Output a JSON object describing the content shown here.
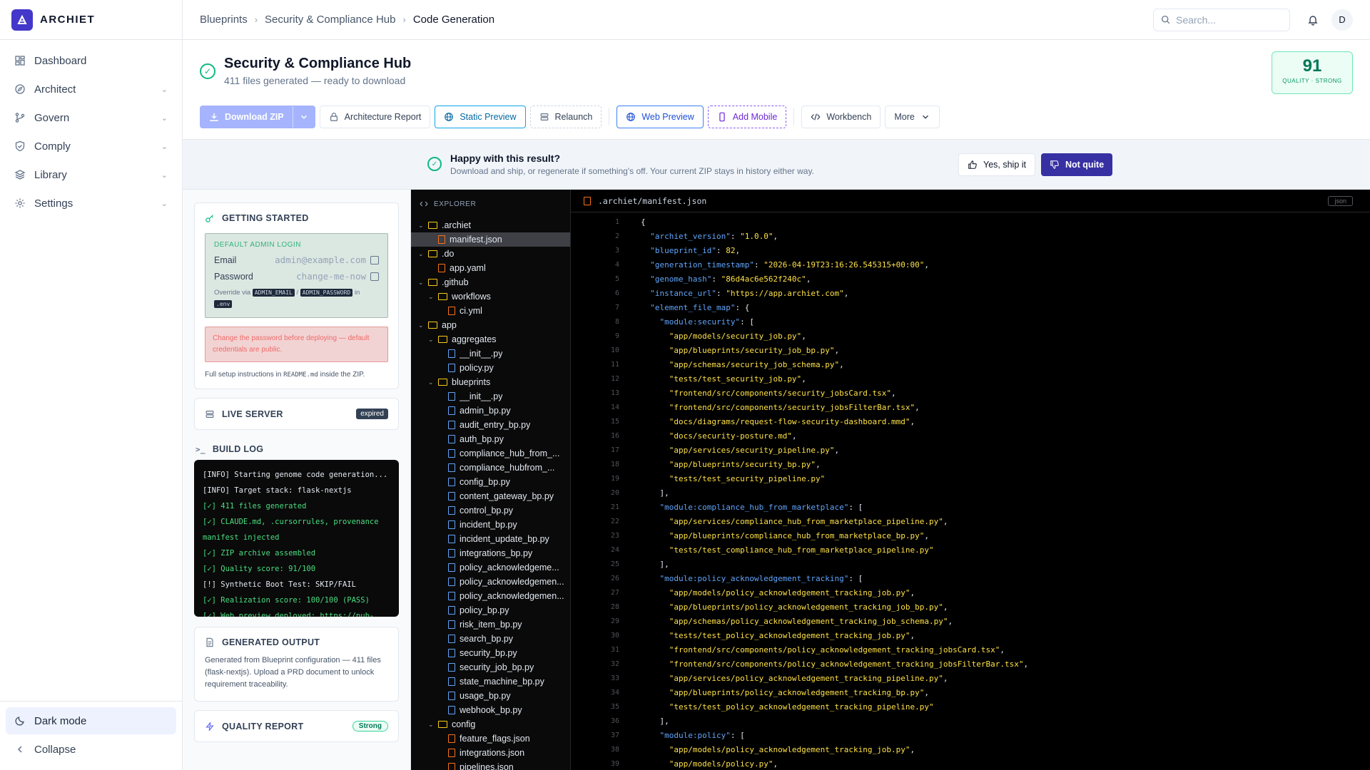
{
  "brand": {
    "name": "ARCHIET"
  },
  "nav": [
    {
      "label": "Dashboard",
      "icon": "dashboard-icon",
      "has_chevron": false
    },
    {
      "label": "Architect",
      "icon": "compass-icon",
      "has_chevron": true
    },
    {
      "label": "Govern",
      "icon": "git-branch-icon",
      "has_chevron": true
    },
    {
      "label": "Comply",
      "icon": "shield-icon",
      "has_chevron": true
    },
    {
      "label": "Library",
      "icon": "layers-icon",
      "has_chevron": true
    },
    {
      "label": "Settings",
      "icon": "gear-icon",
      "has_chevron": true
    }
  ],
  "sidebar_bottom": {
    "dark_mode": "Dark mode",
    "collapse": "Collapse"
  },
  "breadcrumb": [
    "Blueprints",
    "Security & Compliance Hub",
    "Code Generation"
  ],
  "search": {
    "placeholder": "Search..."
  },
  "user": {
    "initial": "D"
  },
  "project": {
    "title": "Security & Compliance Hub",
    "subtitle": "411 files generated — ready to download",
    "quality_score": "91",
    "quality_label": "QUALITY · STRONG"
  },
  "toolbar": {
    "download": "Download ZIP",
    "architecture_report": "Architecture Report",
    "static_preview": "Static Preview",
    "relaunch": "Relaunch",
    "web_preview": "Web Preview",
    "add_mobile": "Add Mobile",
    "workbench": "Workbench",
    "more": "More"
  },
  "feedback": {
    "title": "Happy with this result?",
    "subtitle": "Download and ship, or regenerate if something's off. Your current ZIP stays in history either way.",
    "yes": "Yes, ship it",
    "no": "Not quite"
  },
  "getting_started": {
    "title": "GETTING STARTED",
    "login_label": "DEFAULT ADMIN LOGIN",
    "email_label": "Email",
    "email_value": "admin@example.com",
    "password_label": "Password",
    "password_value": "change-me-now",
    "override_prefix": "Override via",
    "override_tag1": "ADMIN_EMAIL",
    "override_slash": "/",
    "override_tag2": "ADMIN_PASSWORD",
    "override_in": "in",
    "override_tag3": ".env",
    "warning": "Change the password before deploying — default credentials are public.",
    "setup_prefix": "Full setup instructions in",
    "setup_file": "README.md",
    "setup_suffix": "inside the ZIP."
  },
  "live_server": {
    "title": "LIVE SERVER",
    "status": "expired"
  },
  "build_log": {
    "title": "BUILD LOG",
    "lines": [
      {
        "text": "[INFO] Starting genome code generation...",
        "kind": "info"
      },
      {
        "text": "[INFO] Target stack: flask-nextjs",
        "kind": "info"
      },
      {
        "text": "[✓] 411 files generated",
        "kind": "ok"
      },
      {
        "text": "[✓] CLAUDE.md, .cursorrules, provenance",
        "kind": "ok"
      },
      {
        "text": "manifest injected",
        "kind": "ok"
      },
      {
        "text": "[✓] ZIP archive assembled",
        "kind": "ok"
      },
      {
        "text": "[✓] Quality score: 91/100",
        "kind": "ok"
      },
      {
        "text": "[!] Synthetic Boot Test: SKIP/FAIL",
        "kind": "info"
      },
      {
        "text": "[✓] Realization score: 100/100 (PASS)",
        "kind": "ok"
      },
      {
        "text": "[✓] Web preview deployed: https://pub-",
        "kind": "ok"
      }
    ]
  },
  "generated_output": {
    "title": "GENERATED OUTPUT",
    "text": "Generated from Blueprint configuration — 411 files (flask-nextjs). Upload a PRD document to unlock requirement traceability."
  },
  "quality_report": {
    "title": "QUALITY REPORT",
    "badge": "Strong"
  },
  "explorer": {
    "title": "EXPLORER",
    "tree": [
      {
        "name": ".archiet",
        "type": "folder",
        "depth": 0
      },
      {
        "name": "manifest.json",
        "type": "json",
        "depth": 1,
        "selected": true
      },
      {
        "name": ".do",
        "type": "folder",
        "depth": 0
      },
      {
        "name": "app.yaml",
        "type": "yaml",
        "depth": 1
      },
      {
        "name": ".github",
        "type": "folder",
        "depth": 0
      },
      {
        "name": "workflows",
        "type": "folder",
        "depth": 1
      },
      {
        "name": "ci.yml",
        "type": "yaml",
        "depth": 2
      },
      {
        "name": "app",
        "type": "folder",
        "depth": 0
      },
      {
        "name": "aggregates",
        "type": "folder",
        "depth": 1
      },
      {
        "name": "__init__.py",
        "type": "py",
        "depth": 2
      },
      {
        "name": "policy.py",
        "type": "py",
        "depth": 2
      },
      {
        "name": "blueprints",
        "type": "folder",
        "depth": 1
      },
      {
        "name": "__init__.py",
        "type": "py",
        "depth": 2
      },
      {
        "name": "admin_bp.py",
        "type": "py",
        "depth": 2
      },
      {
        "name": "audit_entry_bp.py",
        "type": "py",
        "depth": 2
      },
      {
        "name": "auth_bp.py",
        "type": "py",
        "depth": 2
      },
      {
        "name": "compliance_hub_from_...",
        "type": "py",
        "depth": 2
      },
      {
        "name": "compliance_hubfrom_...",
        "type": "py",
        "depth": 2
      },
      {
        "name": "config_bp.py",
        "type": "py",
        "depth": 2
      },
      {
        "name": "content_gateway_bp.py",
        "type": "py",
        "depth": 2
      },
      {
        "name": "control_bp.py",
        "type": "py",
        "depth": 2
      },
      {
        "name": "incident_bp.py",
        "type": "py",
        "depth": 2
      },
      {
        "name": "incident_update_bp.py",
        "type": "py",
        "depth": 2
      },
      {
        "name": "integrations_bp.py",
        "type": "py",
        "depth": 2
      },
      {
        "name": "policy_acknowledgeme...",
        "type": "py",
        "depth": 2
      },
      {
        "name": "policy_acknowledgemen...",
        "type": "py",
        "depth": 2
      },
      {
        "name": "policy_acknowledgemen...",
        "type": "py",
        "depth": 2
      },
      {
        "name": "policy_bp.py",
        "type": "py",
        "depth": 2
      },
      {
        "name": "risk_item_bp.py",
        "type": "py",
        "depth": 2
      },
      {
        "name": "search_bp.py",
        "type": "py",
        "depth": 2
      },
      {
        "name": "security_bp.py",
        "type": "py",
        "depth": 2
      },
      {
        "name": "security_job_bp.py",
        "type": "py",
        "depth": 2
      },
      {
        "name": "state_machine_bp.py",
        "type": "py",
        "depth": 2
      },
      {
        "name": "usage_bp.py",
        "type": "py",
        "depth": 2
      },
      {
        "name": "webhook_bp.py",
        "type": "py",
        "depth": 2
      },
      {
        "name": "config",
        "type": "folder",
        "depth": 1
      },
      {
        "name": "feature_flags.json",
        "type": "json",
        "depth": 2
      },
      {
        "name": "integrations.json",
        "type": "json",
        "depth": 2
      },
      {
        "name": "pipelines.json",
        "type": "json",
        "depth": 2
      }
    ]
  },
  "editor": {
    "filename": ".archiet/manifest.json",
    "language": "json",
    "lines": [
      [
        [
          "p",
          "{"
        ]
      ],
      [
        [
          "p",
          "  "
        ],
        [
          "k",
          "\"archiet_version\""
        ],
        [
          "p",
          ": "
        ],
        [
          "s",
          "\"1.0.0\""
        ],
        [
          "p",
          ","
        ]
      ],
      [
        [
          "p",
          "  "
        ],
        [
          "k",
          "\"blueprint_id\""
        ],
        [
          "p",
          ": "
        ],
        [
          "s",
          "82"
        ],
        [
          "p",
          ","
        ]
      ],
      [
        [
          "p",
          "  "
        ],
        [
          "k",
          "\"generation_timestamp\""
        ],
        [
          "p",
          ": "
        ],
        [
          "s",
          "\"2026-04-19T23:16:26.545315+00:00\""
        ],
        [
          "p",
          ","
        ]
      ],
      [
        [
          "p",
          "  "
        ],
        [
          "k",
          "\"genome_hash\""
        ],
        [
          "p",
          ": "
        ],
        [
          "s",
          "\"86d4ac6e562f240c\""
        ],
        [
          "p",
          ","
        ]
      ],
      [
        [
          "p",
          "  "
        ],
        [
          "k",
          "\"instance_url\""
        ],
        [
          "p",
          ": "
        ],
        [
          "s",
          "\"https://app.archiet.com\""
        ],
        [
          "p",
          ","
        ]
      ],
      [
        [
          "p",
          "  "
        ],
        [
          "k",
          "\"element_file_map\""
        ],
        [
          "p",
          ": {"
        ]
      ],
      [
        [
          "p",
          "    "
        ],
        [
          "k",
          "\"module:security\""
        ],
        [
          "p",
          ": ["
        ]
      ],
      [
        [
          "p",
          "      "
        ],
        [
          "s",
          "\"app/models/security_job.py\""
        ],
        [
          "p",
          ","
        ]
      ],
      [
        [
          "p",
          "      "
        ],
        [
          "s",
          "\"app/blueprints/security_job_bp.py\""
        ],
        [
          "p",
          ","
        ]
      ],
      [
        [
          "p",
          "      "
        ],
        [
          "s",
          "\"app/schemas/security_job_schema.py\""
        ],
        [
          "p",
          ","
        ]
      ],
      [
        [
          "p",
          "      "
        ],
        [
          "s",
          "\"tests/test_security_job.py\""
        ],
        [
          "p",
          ","
        ]
      ],
      [
        [
          "p",
          "      "
        ],
        [
          "s",
          "\"frontend/src/components/security_jobsCard.tsx\""
        ],
        [
          "p",
          ","
        ]
      ],
      [
        [
          "p",
          "      "
        ],
        [
          "s",
          "\"frontend/src/components/security_jobsFilterBar.tsx\""
        ],
        [
          "p",
          ","
        ]
      ],
      [
        [
          "p",
          "      "
        ],
        [
          "s",
          "\"docs/diagrams/request-flow-security-dashboard.mmd\""
        ],
        [
          "p",
          ","
        ]
      ],
      [
        [
          "p",
          "      "
        ],
        [
          "s",
          "\"docs/security-posture.md\""
        ],
        [
          "p",
          ","
        ]
      ],
      [
        [
          "p",
          "      "
        ],
        [
          "s",
          "\"app/services/security_pipeline.py\""
        ],
        [
          "p",
          ","
        ]
      ],
      [
        [
          "p",
          "      "
        ],
        [
          "s",
          "\"app/blueprints/security_bp.py\""
        ],
        [
          "p",
          ","
        ]
      ],
      [
        [
          "p",
          "      "
        ],
        [
          "s",
          "\"tests/test_security_pipeline.py\""
        ]
      ],
      [
        [
          "p",
          "    ],"
        ]
      ],
      [
        [
          "p",
          "    "
        ],
        [
          "k",
          "\"module:compliance_hub_from_marketplace\""
        ],
        [
          "p",
          ": ["
        ]
      ],
      [
        [
          "p",
          "      "
        ],
        [
          "s",
          "\"app/services/compliance_hub_from_marketplace_pipeline.py\""
        ],
        [
          "p",
          ","
        ]
      ],
      [
        [
          "p",
          "      "
        ],
        [
          "s",
          "\"app/blueprints/compliance_hub_from_marketplace_bp.py\""
        ],
        [
          "p",
          ","
        ]
      ],
      [
        [
          "p",
          "      "
        ],
        [
          "s",
          "\"tests/test_compliance_hub_from_marketplace_pipeline.py\""
        ]
      ],
      [
        [
          "p",
          "    ],"
        ]
      ],
      [
        [
          "p",
          "    "
        ],
        [
          "k",
          "\"module:policy_acknowledgement_tracking\""
        ],
        [
          "p",
          ": ["
        ]
      ],
      [
        [
          "p",
          "      "
        ],
        [
          "s",
          "\"app/models/policy_acknowledgement_tracking_job.py\""
        ],
        [
          "p",
          ","
        ]
      ],
      [
        [
          "p",
          "      "
        ],
        [
          "s",
          "\"app/blueprints/policy_acknowledgement_tracking_job_bp.py\""
        ],
        [
          "p",
          ","
        ]
      ],
      [
        [
          "p",
          "      "
        ],
        [
          "s",
          "\"app/schemas/policy_acknowledgement_tracking_job_schema.py\""
        ],
        [
          "p",
          ","
        ]
      ],
      [
        [
          "p",
          "      "
        ],
        [
          "s",
          "\"tests/test_policy_acknowledgement_tracking_job.py\""
        ],
        [
          "p",
          ","
        ]
      ],
      [
        [
          "p",
          "      "
        ],
        [
          "s",
          "\"frontend/src/components/policy_acknowledgement_tracking_jobsCard.tsx\""
        ],
        [
          "p",
          ","
        ]
      ],
      [
        [
          "p",
          "      "
        ],
        [
          "s",
          "\"frontend/src/components/policy_acknowledgement_tracking_jobsFilterBar.tsx\""
        ],
        [
          "p",
          ","
        ]
      ],
      [
        [
          "p",
          "      "
        ],
        [
          "s",
          "\"app/services/policy_acknowledgement_tracking_pipeline.py\""
        ],
        [
          "p",
          ","
        ]
      ],
      [
        [
          "p",
          "      "
        ],
        [
          "s",
          "\"app/blueprints/policy_acknowledgement_tracking_bp.py\""
        ],
        [
          "p",
          ","
        ]
      ],
      [
        [
          "p",
          "      "
        ],
        [
          "s",
          "\"tests/test_policy_acknowledgement_tracking_pipeline.py\""
        ]
      ],
      [
        [
          "p",
          "    ],"
        ]
      ],
      [
        [
          "p",
          "    "
        ],
        [
          "k",
          "\"module:policy\""
        ],
        [
          "p",
          ": ["
        ]
      ],
      [
        [
          "p",
          "      "
        ],
        [
          "s",
          "\"app/models/policy_acknowledgement_tracking_job.py\""
        ],
        [
          "p",
          ","
        ]
      ],
      [
        [
          "p",
          "      "
        ],
        [
          "s",
          "\"app/models/policy.py\""
        ],
        [
          "p",
          ","
        ]
      ]
    ]
  },
  "colors": {
    "brand": "#4338ca",
    "accent_green": "#10b981",
    "not_quite": "#3730a3",
    "code_key": "#60a5fa",
    "code_string": "#fde047"
  }
}
